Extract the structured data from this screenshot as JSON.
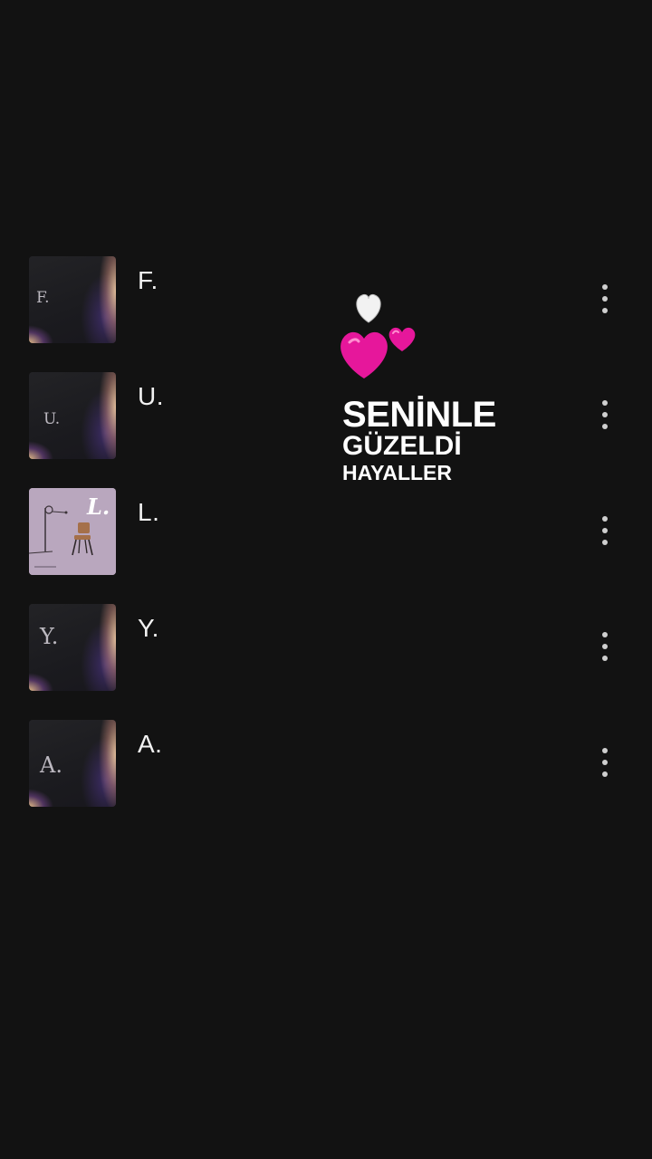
{
  "tracks": [
    {
      "title": "F.",
      "cover_letter": "F.",
      "cover_style": "dark"
    },
    {
      "title": "U.",
      "cover_letter": "U.",
      "cover_style": "dark"
    },
    {
      "title": "L.",
      "cover_letter": "L.",
      "cover_style": "light"
    },
    {
      "title": "Y.",
      "cover_letter": "Y.",
      "cover_style": "dark"
    },
    {
      "title": "A.",
      "cover_letter": "A.",
      "cover_style": "dark"
    }
  ],
  "overlay": {
    "line1": "SENİNLE",
    "line2": "GÜZELDİ",
    "line3": "HAYALLER",
    "emoji": [
      "white-heart-icon",
      "two-hearts-icon"
    ]
  },
  "colors": {
    "background": "#121212",
    "text": "#ffffff",
    "heart_pink": "#e6179b",
    "heart_white": "#f2f2f2"
  },
  "icons": {
    "track_menu": "more-vertical-icon"
  }
}
